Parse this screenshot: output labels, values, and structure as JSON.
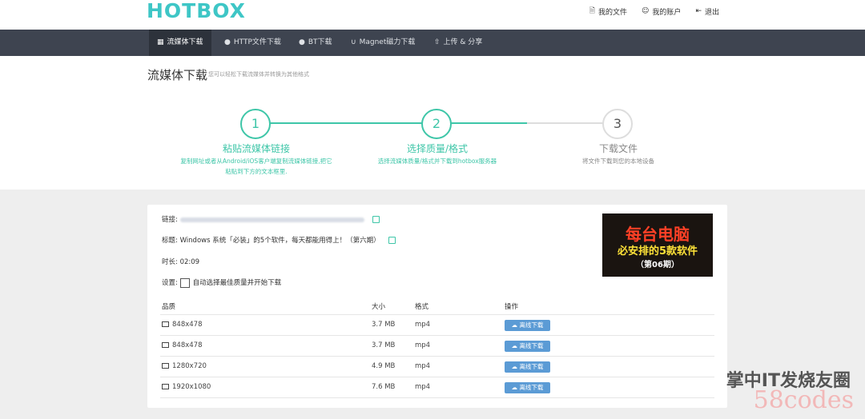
{
  "header": {
    "logo": "HOTBOX",
    "links": [
      {
        "icon": "file-icon",
        "label": "我的文件"
      },
      {
        "icon": "user-icon",
        "label": "我的账户"
      },
      {
        "icon": "logout-icon",
        "label": "退出"
      }
    ]
  },
  "nav": {
    "items": [
      {
        "icon": "media-icon",
        "label": "流媒体下载"
      },
      {
        "icon": "user-icon",
        "label": "HTTP文件下载"
      },
      {
        "icon": "users-icon",
        "label": "BT下载"
      },
      {
        "icon": "magnet-icon",
        "label": "Magnet磁力下载"
      },
      {
        "icon": "upload-icon",
        "label": "上传 & 分享"
      }
    ]
  },
  "page": {
    "title": "流媒体下载",
    "subtitle": "您可以轻松下载流媒体并转换为其他格式"
  },
  "steps": [
    {
      "num": "1",
      "title": "粘贴流媒体链接",
      "desc1": "复制网址或者从Android/iOS客户端复制流媒体链接,把它",
      "desc2": "粘贴到下方的文本框里."
    },
    {
      "num": "2",
      "title": "选择质量/格式",
      "desc1": "选择流媒体质量/格式并下载到hotbox服务器",
      "desc2": ""
    },
    {
      "num": "3",
      "title": "下载文件",
      "desc1": "将文件下载到您的本地设备",
      "desc2": ""
    }
  ],
  "info": {
    "link_label": "链接:",
    "title_label": "标题:",
    "title_value": "Windows 系统「必装」的5个软件，每天都能用得上！（第六期）",
    "duration_label": "时长:",
    "duration_value": "02:09",
    "settings_label": "设置:",
    "settings_checkbox": "自动选择最佳质量并开始下载"
  },
  "thumbnail": {
    "line1": "每台电脑",
    "line2": "必安排的5款软件",
    "line3": "（第06期）"
  },
  "table": {
    "headers": {
      "quality": "品质",
      "size": "大小",
      "format": "格式",
      "action": "操作"
    },
    "rows": [
      {
        "quality": "848x478",
        "size": "3.7 MB",
        "format": "mp4",
        "action": "离线下载"
      },
      {
        "quality": "848x478",
        "size": "3.7 MB",
        "format": "mp4",
        "action": "离线下载"
      },
      {
        "quality": "1280x720",
        "size": "4.9 MB",
        "format": "mp4",
        "action": "离线下载"
      },
      {
        "quality": "1920x1080",
        "size": "7.6 MB",
        "format": "mp4",
        "action": "离线下载"
      }
    ]
  },
  "watermark": {
    "line1": "掌中IT发烧友圈",
    "line2": "58codes"
  },
  "colors": {
    "accent": "#3ec6a8",
    "logo": "#3ec6c6",
    "nav_bg": "#3e4450",
    "button": "#5b9bd5"
  }
}
